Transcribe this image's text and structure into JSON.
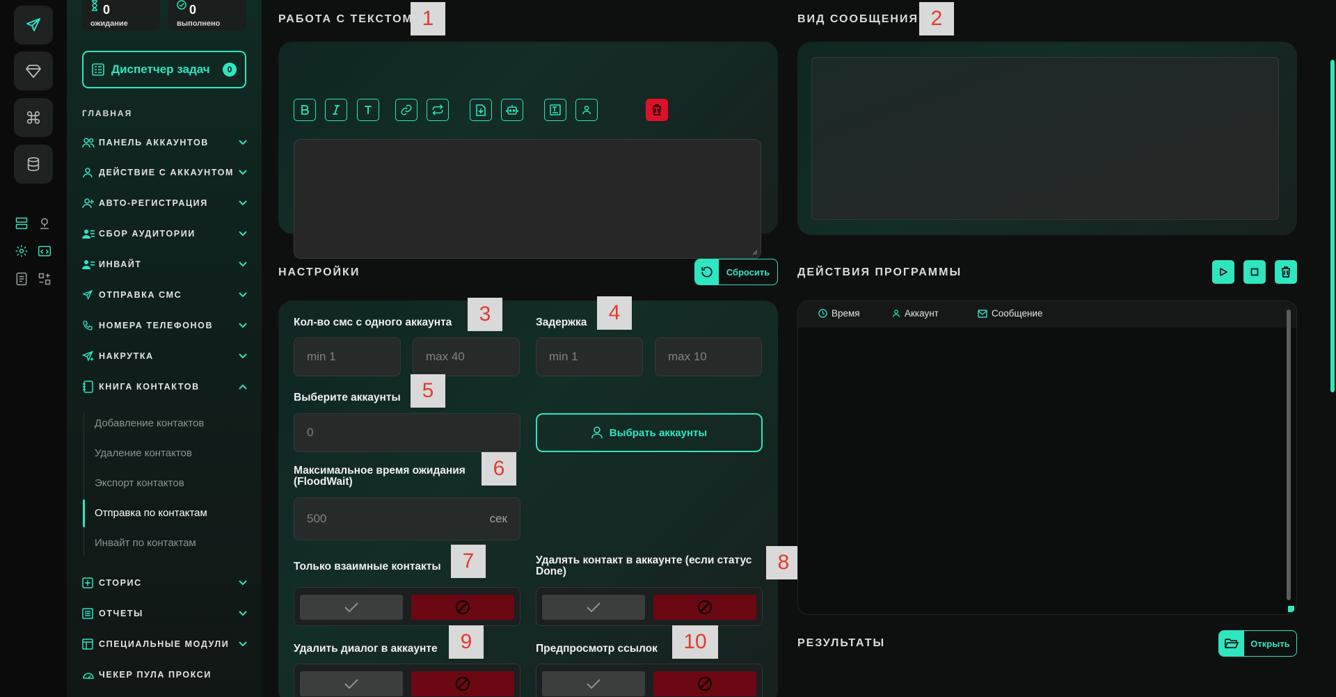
{
  "stats": {
    "waiting": {
      "value": "0",
      "label": "ожидание"
    },
    "done": {
      "value": "0",
      "label": "выполнено"
    }
  },
  "dispatcher": {
    "label": "Диспетчер задач",
    "count": "0"
  },
  "sidebar": {
    "section": "ГЛАВНАЯ",
    "items": [
      {
        "label": "ПАНЕЛЬ АККАУНТОВ"
      },
      {
        "label": "ДЕЙСТВИЕ С АККАУНТОМ"
      },
      {
        "label": "АВТО-РЕГИСТРАЦИЯ"
      },
      {
        "label": "СБОР АУДИТОРИИ"
      },
      {
        "label": "ИНВАЙТ"
      },
      {
        "label": "ОТПРАВКА СМС"
      },
      {
        "label": "НОМЕРА ТЕЛЕФОНОВ"
      },
      {
        "label": "НАКРУТКА"
      },
      {
        "label": "КНИГА КОНТАКТОВ"
      },
      {
        "label": "СТОРИС"
      },
      {
        "label": "ОТЧЕТЫ"
      },
      {
        "label": "СПЕЦИАЛЬНЫЕ МОДУЛИ"
      },
      {
        "label": "ЧЕКЕР ПУЛА ПРОКСИ"
      }
    ],
    "subitems": [
      {
        "label": "Добавление контактов"
      },
      {
        "label": "Удаление контактов"
      },
      {
        "label": "Экспорт контактов"
      },
      {
        "label": "Отправка по контактам"
      },
      {
        "label": "Инвайт по контактам"
      }
    ]
  },
  "text_work": {
    "title": "РАБОТА С ТЕКСТОМ"
  },
  "message_view": {
    "title": "ВИД СООБЩЕНИЯ"
  },
  "settings": {
    "title": "НАСТРОЙКИ",
    "reset_label": "Сбросить",
    "sms_count": {
      "label": "Кол-во смс с одного аккаунта",
      "min": "min  1",
      "max": "max  40"
    },
    "delay": {
      "label": "Задержка",
      "min": "min  1",
      "max": "max  10"
    },
    "accounts": {
      "label": "Выберите аккаунты",
      "value": "0",
      "button": "Выбрать аккаунты"
    },
    "floodwait": {
      "label_line1": "Максимальное время ожидания",
      "label_line2": "(FloodWait)",
      "value": "500",
      "suffix": "сек"
    },
    "mutual": {
      "label": "Только взаимные контакты"
    },
    "delete_contact": {
      "label_line1": "Удалять контакт в аккаунте (если статус",
      "label_line2": "Done)"
    },
    "delete_dialog": {
      "label": "Удалить диалог в аккаунте"
    },
    "link_preview": {
      "label": "Предпросмотр ссылок"
    }
  },
  "program_actions": {
    "title": "ДЕЙСТВИЯ ПРОГРАММЫ",
    "columns": [
      "Время",
      "Аккаунт",
      "Сообщение"
    ]
  },
  "results": {
    "title": "РЕЗУЛЬТАТЫ",
    "open_label": "Открыть"
  },
  "markers": [
    "1",
    "2",
    "3",
    "4",
    "5",
    "6",
    "7",
    "8",
    "9",
    "10"
  ],
  "colors": {
    "accent": "#2ee6c0",
    "danger": "#e0102a",
    "danger_dark": "#6b0713"
  }
}
